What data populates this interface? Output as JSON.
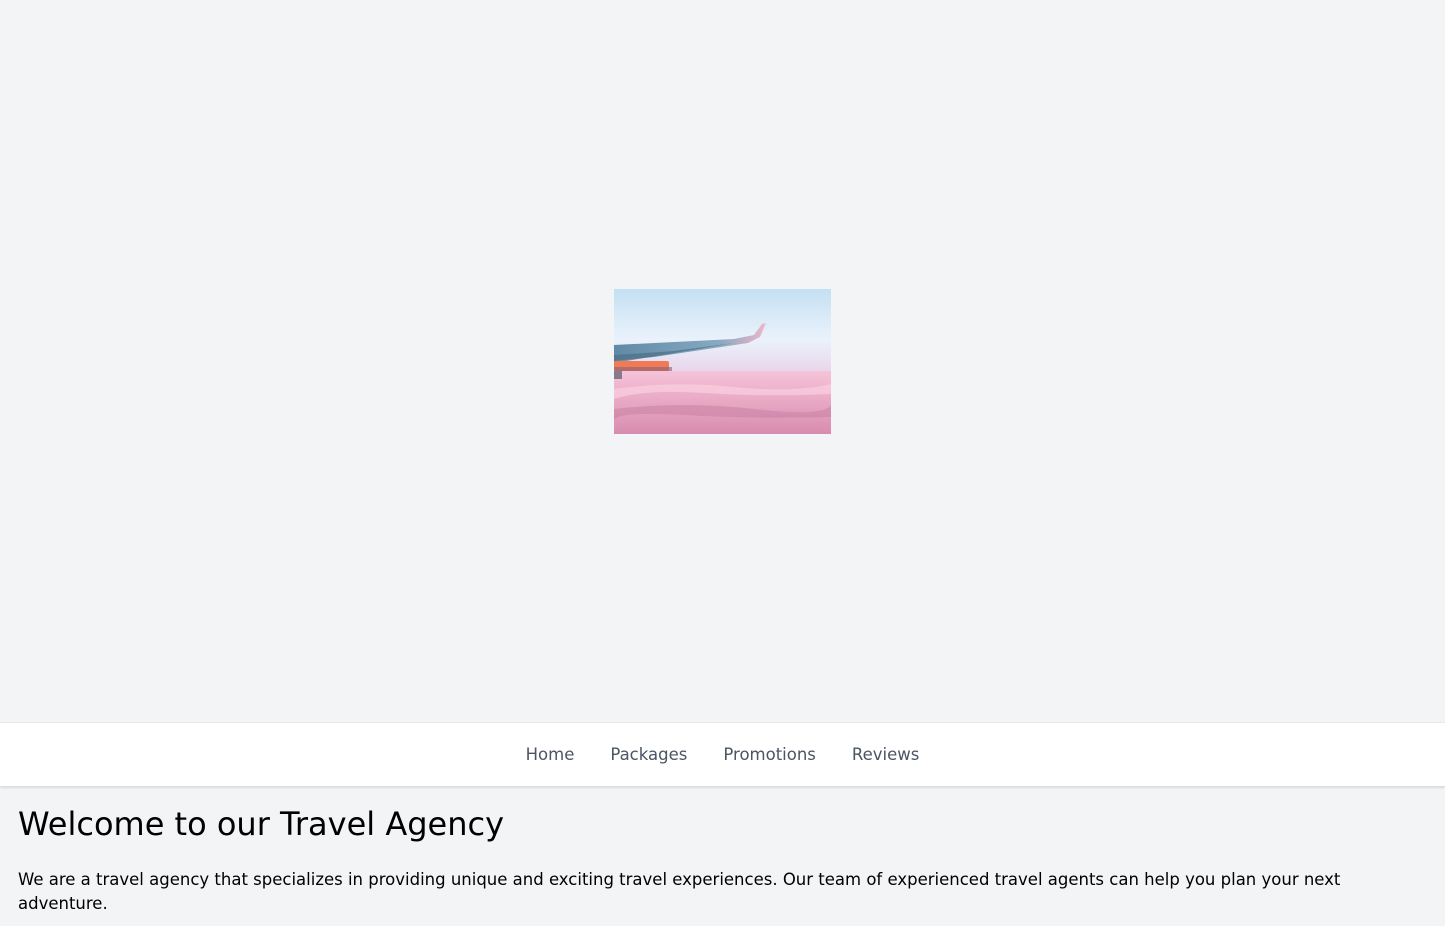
{
  "hero": {
    "image_alt": "Airplane wing above pink clouds",
    "colors": {
      "sky_top": "#cfe6f5",
      "sky_mid": "#e8eef7",
      "cloud_pink": "#f0a8c4",
      "wing": "#6f93b0",
      "engine": "#f07a55"
    }
  },
  "nav": {
    "items": [
      {
        "label": "Home"
      },
      {
        "label": "Packages"
      },
      {
        "label": "Promotions"
      },
      {
        "label": "Reviews"
      }
    ]
  },
  "main": {
    "title": "Welcome to our Travel Agency",
    "intro": "We are a travel agency that specializes in providing unique and exciting travel experiences. Our team of experienced travel agents can help you plan your next adventure."
  }
}
